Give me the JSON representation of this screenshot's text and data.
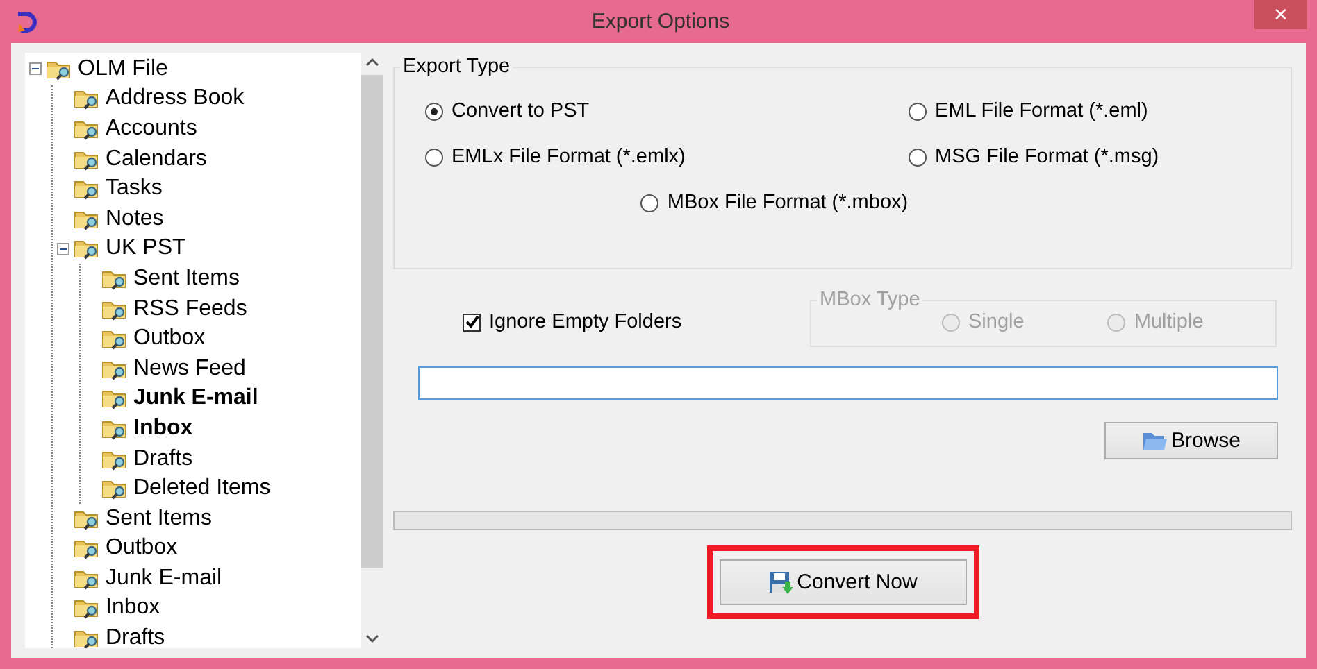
{
  "window": {
    "title": "Export Options",
    "close": "✕"
  },
  "tree": [
    {
      "label": "OLM File",
      "bold": false,
      "expanded": true,
      "children": [
        {
          "label": "Address Book",
          "bold": false
        },
        {
          "label": "Accounts",
          "bold": false
        },
        {
          "label": "Calendars",
          "bold": false
        },
        {
          "label": "Tasks",
          "bold": false
        },
        {
          "label": "Notes",
          "bold": false
        },
        {
          "label": "UK PST",
          "bold": false,
          "expanded": true,
          "children": [
            {
              "label": "Sent Items",
              "bold": false
            },
            {
              "label": "RSS Feeds",
              "bold": false
            },
            {
              "label": "Outbox",
              "bold": false
            },
            {
              "label": "News Feed",
              "bold": false
            },
            {
              "label": "Junk E-mail",
              "bold": true
            },
            {
              "label": "Inbox",
              "bold": true
            },
            {
              "label": "Drafts",
              "bold": false
            },
            {
              "label": "Deleted Items",
              "bold": false
            }
          ]
        },
        {
          "label": "Sent Items",
          "bold": false
        },
        {
          "label": "Outbox",
          "bold": false
        },
        {
          "label": "Junk E-mail",
          "bold": false
        },
        {
          "label": "Inbox",
          "bold": false
        },
        {
          "label": "Drafts",
          "bold": false
        }
      ]
    }
  ],
  "export_type": {
    "title": "Export Type",
    "options": [
      {
        "label": "Convert to PST",
        "selected": true
      },
      {
        "label": "EML File  Format (*.eml)",
        "selected": false
      },
      {
        "label": "EMLx File  Format (*.emlx)",
        "selected": false
      },
      {
        "label": "MSG File Format (*.msg)",
        "selected": false
      },
      {
        "label": "MBox File Format (*.mbox)",
        "selected": false
      }
    ]
  },
  "ignore_empty_folders": {
    "label": "Ignore Empty Folders",
    "checked": true
  },
  "mbox_type": {
    "title": "MBox Type",
    "disabled": true,
    "options": [
      {
        "label": "Single",
        "selected": false
      },
      {
        "label": "Multiple",
        "selected": false
      }
    ]
  },
  "browse_button": "Browse",
  "progress": {
    "level": 0
  },
  "convert_button": "Convert Now"
}
